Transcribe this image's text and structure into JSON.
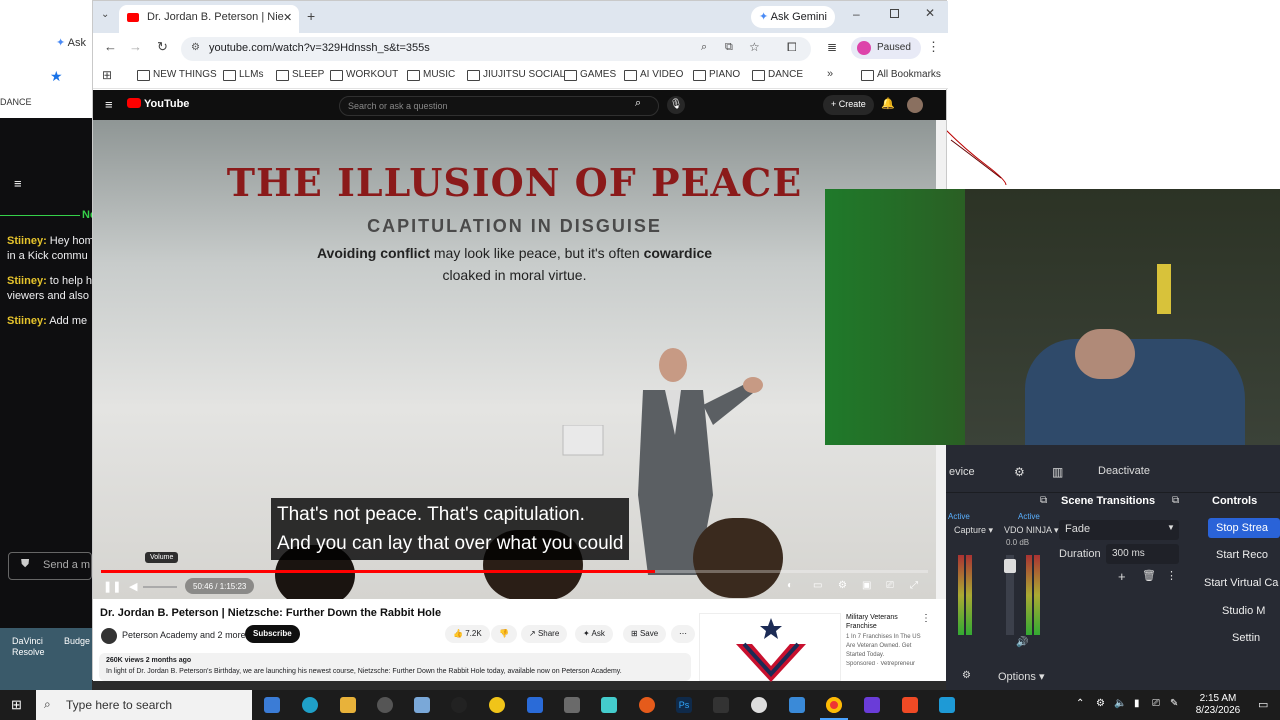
{
  "left_panel": {
    "gemini_label": "Ask",
    "bookmark_item": "DANCE"
  },
  "chat": {
    "header": "Ne",
    "messages": [
      {
        "user": "Stiiney:",
        "text": "Hey hom",
        "cont": "in a Kick commu"
      },
      {
        "user": "Stiiney:",
        "text": "to help h",
        "cont": "viewers and also"
      },
      {
        "user": "Stiiney:",
        "text": "Add me",
        "cont": ""
      }
    ],
    "input_placeholder": "Send a m"
  },
  "desktop_icons": [
    {
      "label": "DaVinci Resolve"
    },
    {
      "label": "Budge"
    }
  ],
  "browser": {
    "tab_title": "Dr. Jordan B. Peterson | Nie",
    "gemini_button": "Ask Gemini",
    "url": "youtube.com/watch?v=329Hdnssh_s&t=355s",
    "profile_status": "Paused",
    "bookmarks": [
      "NEW THINGS",
      "LLMs",
      "SLEEP",
      "WORKOUT",
      "MUSIC",
      "JIUJITSU SOCIAL",
      "GAMES",
      "AI VIDEO",
      "PIANO",
      "DANCE"
    ],
    "all_bookmarks": "All Bookmarks"
  },
  "youtube": {
    "logo": "YouTube",
    "search_placeholder": "Search or ask a question",
    "create_label": "Create",
    "slide": {
      "title_part1": "THE ILLUSION OF",
      "title_part2": "PEACE",
      "subtitle": "CAPITULATION IN DISGUISE",
      "body_a": "Avoiding conflict",
      "body_b": " may look like peace, but it's often ",
      "body_c": "cowardice",
      "body_d": "cloaked in moral virtue."
    },
    "caption_line1": "That's not peace. That's capitulation.",
    "caption_line2": "And you can lay that over what you could",
    "volume_tooltip": "Volume",
    "time": "50:46 / 1:15:23",
    "progress": 0.67,
    "video_title": "Dr. Jordan B. Peterson | Nietzsche: Further Down the Rabbit Hole",
    "channel": "Peterson Academy and 2 more",
    "subscribe": "Subscribe",
    "likes": "7.2K",
    "share": "Share",
    "ask": "Ask",
    "save": "Save",
    "views": "260K views  2 months ago",
    "description": "In light of Dr. Jordan B. Peterson's Birthday, we are launching his newest course, Nietzsche: Further Down the Rabbit Hole today, available now on Peterson Academy.",
    "ad": {
      "title": "Military Veterans Franchise",
      "text": "1 In 7 Franchises In The US Are Veteran Owned. Get Started Today.",
      "sponsor": "Sponsored · Vetrepreneur"
    }
  },
  "obs": {
    "device_label": "evice",
    "deactivate": "Deactivate",
    "scene_transitions": "Scene Transitions",
    "controls": "Controls",
    "active1": "Active",
    "active2": "Active",
    "source1": "Capture",
    "source2": "VDO NINJA",
    "db": "0.0 dB",
    "transition": "Fade",
    "duration_label": "Duration",
    "duration_value": "300 ms",
    "options": "Options",
    "buttons": [
      "Stop Strea",
      "Start Reco",
      "Start Virtual Ca",
      "Studio M",
      "Settin"
    ]
  },
  "taskbar": {
    "search_placeholder": "Type here to search",
    "time": "2:15 AM",
    "date": "8/23/2026"
  }
}
